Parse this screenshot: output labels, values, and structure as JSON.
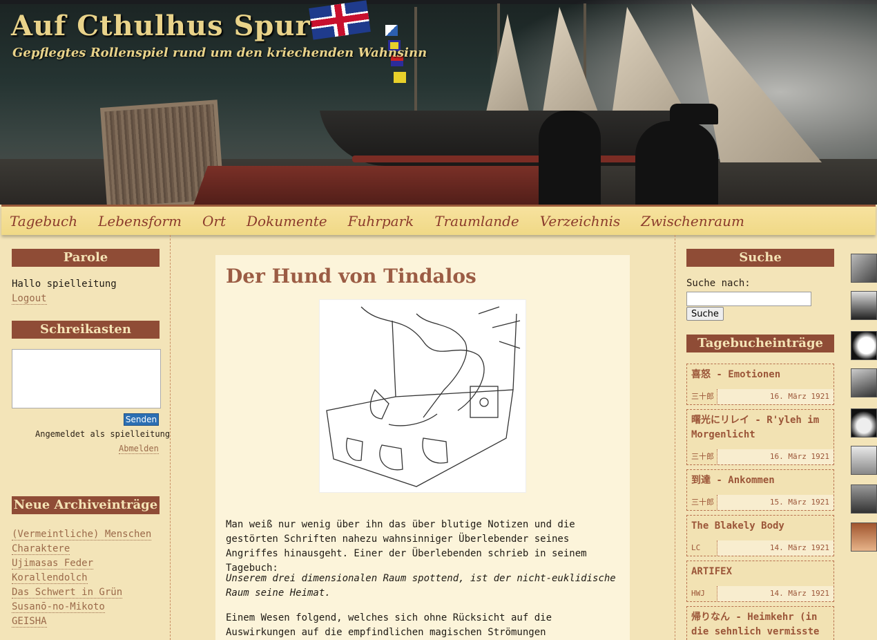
{
  "header": {
    "site_title": "Auf Cthulhus Spur",
    "tagline": "Gepflegtes Rollenspiel rund um den kriechenden Wahnsinn"
  },
  "nav": {
    "items": [
      "Tagebuch",
      "Lebensform",
      "Ort",
      "Dokumente",
      "Fuhrpark",
      "Traumlande",
      "Verzeichnis",
      "Zwischenraum"
    ]
  },
  "left": {
    "parole_title": "Parole",
    "greeting": "Hallo spielleitung",
    "logout": "Logout",
    "shout_title": "Schreikasten",
    "send_label": "Senden",
    "logged_in_as": "Angemeldet als spielleitung",
    "abmelden": "Abmelden",
    "archive_title": "Neue Archiveinträge",
    "archive_items": [
      "(Vermeintliche) Menschen",
      "Charaktere",
      "Ujimasas Feder",
      "Korallendolch",
      "Das Schwert in Grün",
      "Susanō-no-Mikoto",
      "GEISHA"
    ]
  },
  "main": {
    "post_title": "Der Hund von Tindalos",
    "para1": "Man weiß nur wenig über ihn das über blutige Notizen und die gestörten Schriften nahezu wahnsinniger Überlebender seines Angriffes hinausgeht. Einer der Überlebenden schrieb in seinem Tagebuch:",
    "quote": "Unserem drei dimensionalen Raum spottend, ist der nicht-euklidische Raum seine Heimat.",
    "para2": "Einem Wesen folgend, welches sich ohne Rücksicht auf die Auswirkungen auf die empfindlichen magischen Strömungen"
  },
  "right": {
    "search_title": "Suche",
    "search_label": "Suche nach:",
    "search_button": "Suche",
    "entries_title": "Tagebucheinträge",
    "entries": [
      {
        "title": "喜怒 - Emotionen",
        "author": "三十郎",
        "date": "16. März 1921"
      },
      {
        "title": "曙光にリレイ - R'yleh im Morgenlicht",
        "author": "三十郎",
        "date": "16. März 1921"
      },
      {
        "title": "到達 - Ankommen",
        "author": "三十郎",
        "date": "15. März 1921"
      },
      {
        "title": "The Blakely Body",
        "author": "LC",
        "date": "14. März 1921"
      },
      {
        "title": "ARTIFEX",
        "author": "HWJ",
        "date": "14. März 1921"
      },
      {
        "title": "帰りなん - Heimkehr (in die sehnlich vermisste",
        "author": "",
        "date": ""
      }
    ]
  },
  "colors": {
    "accent": "#8f4c36",
    "background": "#f3e4b8",
    "nav_text": "#8b3b2c"
  }
}
